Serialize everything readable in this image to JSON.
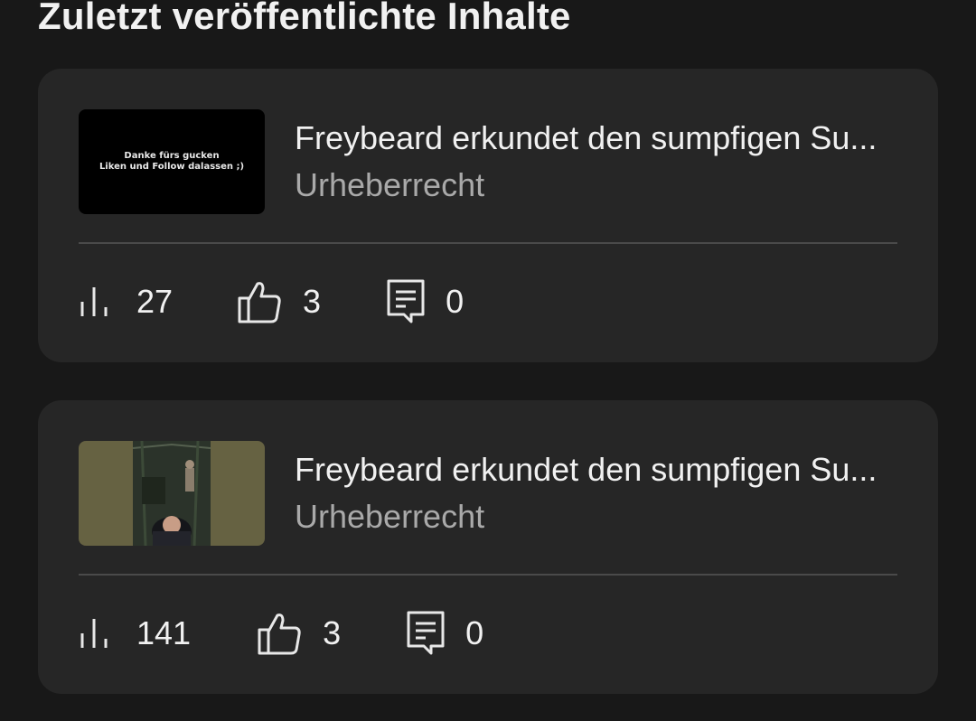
{
  "section": {
    "title": "Zuletzt veröffentlichte Inhalte"
  },
  "items": [
    {
      "thumbnail": {
        "kind": "black-text",
        "lines": [
          "Danke fürs gucken",
          "Liken und Follow dalassen ;)"
        ]
      },
      "title": "Freybeard erkundet den sumpfigen Su...",
      "subtitle": "Urheberrecht",
      "stats": {
        "views": "27",
        "likes": "3",
        "comments": "0"
      }
    },
    {
      "thumbnail": {
        "kind": "game-scene"
      },
      "title": "Freybeard erkundet den sumpfigen Su...",
      "subtitle": "Urheberrecht",
      "stats": {
        "views": "141",
        "likes": "3",
        "comments": "0"
      }
    }
  ],
  "icons": {
    "views": "bar-chart-icon",
    "likes": "thumbs-up-icon",
    "comments": "comment-icon"
  },
  "colors": {
    "background": "#181818",
    "card": "#262626",
    "text": "#f1f1f1",
    "muted": "#a9a9a9"
  }
}
